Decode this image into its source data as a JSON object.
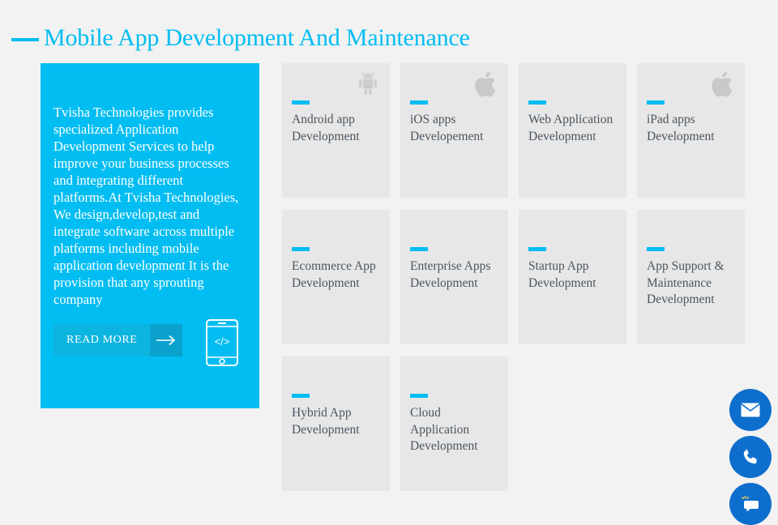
{
  "page": {
    "title": "Mobile App Development And Maintenance",
    "background_color": "#f2f2f2",
    "accent_color": "#00bdf2"
  },
  "intro_panel": {
    "background_color": "#02bdf2",
    "body_text": "Tvisha Technologies provides specialized Application Development Services to help improve your business processes and integrating different platforms.At Tvisha Technologies, We design,develop,test and integrate software across multiple platforms including mobile application development It is the provision that any sprouting company",
    "read_more_label": "READ MORE",
    "arrow_icon": "arrow-right-icon",
    "decor_icon": "phone-code-icon"
  },
  "cards": [
    {
      "title": "Android app Development",
      "icon": "android-icon"
    },
    {
      "title": "iOS apps Developement",
      "icon": "apple-icon"
    },
    {
      "title": "Web Application Development",
      "icon": ""
    },
    {
      "title": "iPad apps Development",
      "icon": "apple-icon"
    },
    {
      "title": "Ecommerce App Development",
      "icon": ""
    },
    {
      "title": "Enterprise Apps Development",
      "icon": ""
    },
    {
      "title": "Startup App Development",
      "icon": ""
    },
    {
      "title": "App Support & Maintenance Development",
      "icon": ""
    },
    {
      "title": "Hybrid App Development",
      "icon": ""
    },
    {
      "title": "Cloud Application Development",
      "icon": ""
    }
  ],
  "floating_actions": {
    "color": "#0d6ecd",
    "items": [
      {
        "name": "email-fab",
        "icon": "envelope-icon"
      },
      {
        "name": "phone-fab",
        "icon": "phone-icon"
      },
      {
        "name": "chat-fab",
        "icon": "chat-bubble-icon"
      }
    ]
  }
}
